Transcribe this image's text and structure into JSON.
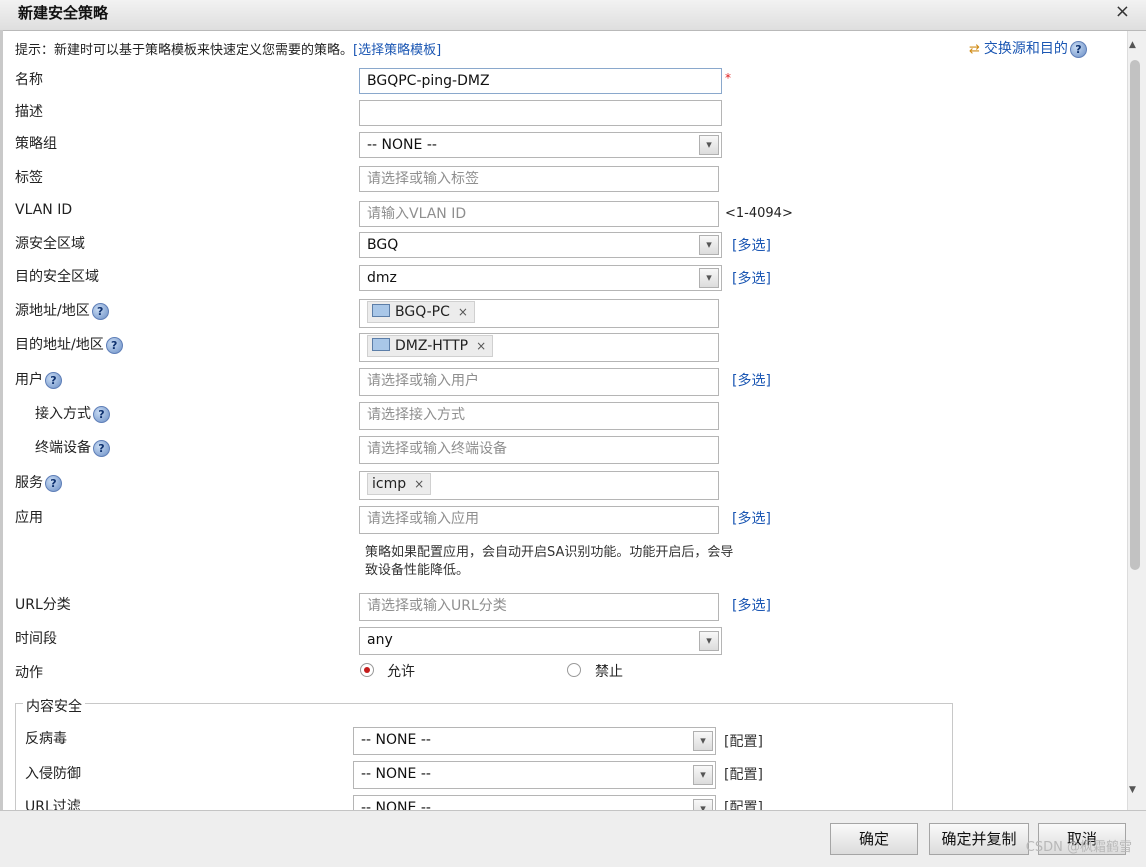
{
  "dialog": {
    "title": "新建安全策略"
  },
  "tip": {
    "text": "提示：新建时可以基于策略模板来快速定义您需要的策略。",
    "link": "[选择策略模板]"
  },
  "swap": {
    "label": "交换源和目的"
  },
  "icons": {
    "help": "?",
    "close": "×",
    "dropdown": "▾",
    "chip_remove": "×",
    "swap": "⇄",
    "scroll_up": "▲",
    "scroll_down": "▼"
  },
  "labels": {
    "name": "名称",
    "desc": "描述",
    "group": "策略组",
    "tag": "标签",
    "vlan": "VLAN ID",
    "src_zone": "源安全区域",
    "dst_zone": "目的安全区域",
    "src_addr": "源地址/地区",
    "dst_addr": "目的地址/地区",
    "user": "用户",
    "access": "接入方式",
    "terminal": "终端设备",
    "service": "服务",
    "app": "应用",
    "url": "URL分类",
    "time": "时间段",
    "action": "动作"
  },
  "fields": {
    "name_value": "BGQPC-ping-DMZ",
    "desc_value": "",
    "group_value": "-- NONE --",
    "tag_placeholder": "请选择或输入标签",
    "vlan_placeholder": "请输入VLAN ID",
    "vlan_range": "<1-4094>",
    "src_zone_value": "BGQ",
    "dst_zone_value": "dmz",
    "src_addr_chip": "BGQ-PC",
    "dst_addr_chip": "DMZ-HTTP",
    "user_placeholder": "请选择或输入用户",
    "access_placeholder": "请选择接入方式",
    "terminal_placeholder": "请选择或输入终端设备",
    "service_chip": "icmp",
    "app_placeholder": "请选择或输入应用",
    "url_placeholder": "请选择或输入URL分类",
    "time_value": "any"
  },
  "required_mark": "*",
  "multi_select": "[多选]",
  "app_note": "策略如果配置应用，会自动开启SA识别功能。功能开启后，会导致设备性能降低。",
  "action": {
    "allow": "允许",
    "deny": "禁止",
    "selected": "allow"
  },
  "content_security": {
    "legend": "内容安全",
    "config_label": "[配置]",
    "rows": [
      {
        "label": "反病毒",
        "value": "-- NONE --"
      },
      {
        "label": "入侵防御",
        "value": "-- NONE --"
      },
      {
        "label": "URL过滤",
        "value": "-- NONE --"
      }
    ]
  },
  "footer": {
    "ok": "确定",
    "ok_copy": "确定并复制",
    "cancel": "取消",
    "watermark": "CSDN @枫霜鹤雪"
  },
  "colors": {
    "link": "#1a56b3",
    "required": "#e02020",
    "radio_selected": "#c41c1c"
  }
}
